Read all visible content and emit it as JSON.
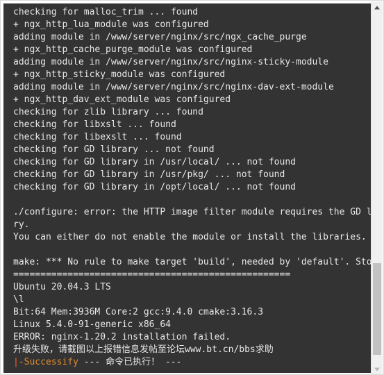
{
  "terminal": {
    "background_color": "#333333",
    "text_color": "#e8e8e8",
    "cursor_color": "#d64e2a",
    "highlight_color": "#e08b34",
    "lines": [
      "checking for malloc_trim ... found",
      "+ ngx_http_lua_module was configured",
      "adding module in /www/server/nginx/src/ngx_cache_purge",
      "+ ngx_http_cache_purge_module was configured",
      "adding module in /www/server/nginx/src/nginx-sticky-module",
      "+ ngx_http_sticky_module was configured",
      "adding module in /www/server/nginx/src/nginx-dav-ext-module",
      "+ ngx_http_dav_ext_module was configured",
      "checking for zlib library ... found",
      "checking for libxslt ... found",
      "checking for libexslt ... found",
      "checking for GD library ... not found",
      "checking for GD library in /usr/local/ ... not found",
      "checking for GD library in /usr/pkg/ ... not found",
      "checking for GD library in /opt/local/ ... not found",
      "",
      "./configure: error: the HTTP image filter module requires the GD libra",
      "ry.",
      "You can either do not enable the module or install the libraries.",
      "",
      "make: *** No rule to make target 'build', needed by 'default'. Stop.",
      "===================================================",
      "Ubuntu 20.04.3 LTS",
      "\\l",
      "Bit:64 Mem:3936M Core:2 gcc:9.4.0 cmake:3.16.3",
      "Linux 5.4.0-91-generic x86_64",
      "ERROR: nginx-1.20.2 installation failed.",
      "升级失败，请截图以上报错信息发帖至论坛www.bt.cn/bbs求助"
    ],
    "final_line": {
      "caret": "|",
      "status_token": "-Successify",
      "separator_left": " --- ",
      "message": "命令已执行！",
      "separator_right": " ---"
    }
  },
  "scrollbar": {
    "up_arrow_icon": "scroll-up-arrow-icon",
    "down_arrow_icon": "scroll-down-arrow-icon",
    "thumb_label": "scroll-thumb"
  }
}
